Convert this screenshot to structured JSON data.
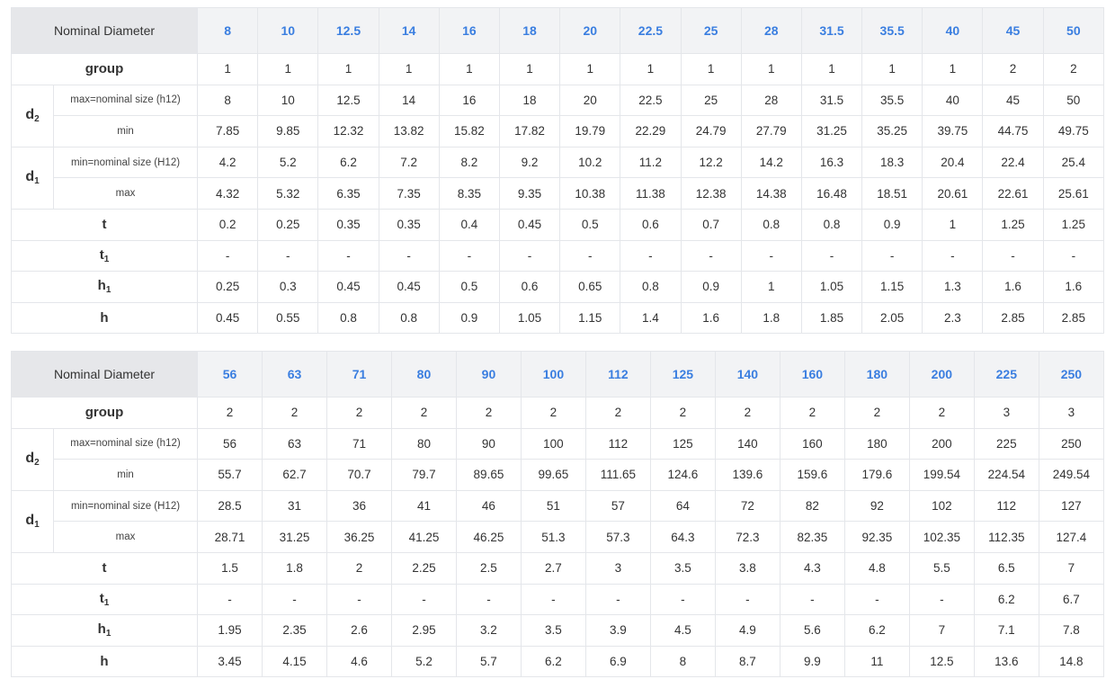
{
  "labels": {
    "nominal_diameter": "Nominal Diameter",
    "group": "group",
    "d_letter": "d",
    "d2_sub": "2",
    "d1_sub": "1",
    "max_nominal_h12": "max=nominal size (h12)",
    "min_nominal_H12": "min=nominal size (H12)",
    "min": "min",
    "max": "max",
    "t": "t",
    "t1_letter": "t",
    "t1_sub": "1",
    "h1_letter": "h",
    "h1_sub": "1",
    "h": "h"
  },
  "tables": [
    {
      "diameters": [
        "8",
        "10",
        "12.5",
        "14",
        "16",
        "18",
        "20",
        "22.5",
        "25",
        "28",
        "31.5",
        "35.5",
        "40",
        "45",
        "50"
      ],
      "group": [
        "1",
        "1",
        "1",
        "1",
        "1",
        "1",
        "1",
        "1",
        "1",
        "1",
        "1",
        "1",
        "1",
        "2",
        "2"
      ],
      "d2_max": [
        "8",
        "10",
        "12.5",
        "14",
        "16",
        "18",
        "20",
        "22.5",
        "25",
        "28",
        "31.5",
        "35.5",
        "40",
        "45",
        "50"
      ],
      "d2_min": [
        "7.85",
        "9.85",
        "12.32",
        "13.82",
        "15.82",
        "17.82",
        "19.79",
        "22.29",
        "24.79",
        "27.79",
        "31.25",
        "35.25",
        "39.75",
        "44.75",
        "49.75"
      ],
      "d1_min": [
        "4.2",
        "5.2",
        "6.2",
        "7.2",
        "8.2",
        "9.2",
        "10.2",
        "11.2",
        "12.2",
        "14.2",
        "16.3",
        "18.3",
        "20.4",
        "22.4",
        "25.4"
      ],
      "d1_max": [
        "4.32",
        "5.32",
        "6.35",
        "7.35",
        "8.35",
        "9.35",
        "10.38",
        "11.38",
        "12.38",
        "14.38",
        "16.48",
        "18.51",
        "20.61",
        "22.61",
        "25.61"
      ],
      "t": [
        "0.2",
        "0.25",
        "0.35",
        "0.35",
        "0.4",
        "0.45",
        "0.5",
        "0.6",
        "0.7",
        "0.8",
        "0.8",
        "0.9",
        "1",
        "1.25",
        "1.25"
      ],
      "t1": [
        "-",
        "-",
        "-",
        "-",
        "-",
        "-",
        "-",
        "-",
        "-",
        "-",
        "-",
        "-",
        "-",
        "-",
        "-"
      ],
      "h1": [
        "0.25",
        "0.3",
        "0.45",
        "0.45",
        "0.5",
        "0.6",
        "0.65",
        "0.8",
        "0.9",
        "1",
        "1.05",
        "1.15",
        "1.3",
        "1.6",
        "1.6"
      ],
      "h": [
        "0.45",
        "0.55",
        "0.8",
        "0.8",
        "0.9",
        "1.05",
        "1.15",
        "1.4",
        "1.6",
        "1.8",
        "1.85",
        "2.05",
        "2.3",
        "2.85",
        "2.85"
      ]
    },
    {
      "diameters": [
        "56",
        "63",
        "71",
        "80",
        "90",
        "100",
        "112",
        "125",
        "140",
        "160",
        "180",
        "200",
        "225",
        "250"
      ],
      "group": [
        "2",
        "2",
        "2",
        "2",
        "2",
        "2",
        "2",
        "2",
        "2",
        "2",
        "2",
        "2",
        "3",
        "3"
      ],
      "d2_max": [
        "56",
        "63",
        "71",
        "80",
        "90",
        "100",
        "112",
        "125",
        "140",
        "160",
        "180",
        "200",
        "225",
        "250"
      ],
      "d2_min": [
        "55.7",
        "62.7",
        "70.7",
        "79.7",
        "89.65",
        "99.65",
        "111.65",
        "124.6",
        "139.6",
        "159.6",
        "179.6",
        "199.54",
        "224.54",
        "249.54"
      ],
      "d1_min": [
        "28.5",
        "31",
        "36",
        "41",
        "46",
        "51",
        "57",
        "64",
        "72",
        "82",
        "92",
        "102",
        "112",
        "127"
      ],
      "d1_max": [
        "28.71",
        "31.25",
        "36.25",
        "41.25",
        "46.25",
        "51.3",
        "57.3",
        "64.3",
        "72.3",
        "82.35",
        "92.35",
        "102.35",
        "112.35",
        "127.4"
      ],
      "t": [
        "1.5",
        "1.8",
        "2",
        "2.25",
        "2.5",
        "2.7",
        "3",
        "3.5",
        "3.8",
        "4.3",
        "4.8",
        "5.5",
        "6.5",
        "7"
      ],
      "t1": [
        "-",
        "-",
        "-",
        "-",
        "-",
        "-",
        "-",
        "-",
        "-",
        "-",
        "-",
        "-",
        "6.2",
        "6.7"
      ],
      "h1": [
        "1.95",
        "2.35",
        "2.6",
        "2.95",
        "3.2",
        "3.5",
        "3.9",
        "4.5",
        "4.9",
        "5.6",
        "6.2",
        "7",
        "7.1",
        "7.8"
      ],
      "h": [
        "3.45",
        "4.15",
        "4.6",
        "5.2",
        "5.7",
        "6.2",
        "6.9",
        "8",
        "8.7",
        "9.9",
        "11",
        "12.5",
        "13.6",
        "14.8"
      ]
    }
  ]
}
